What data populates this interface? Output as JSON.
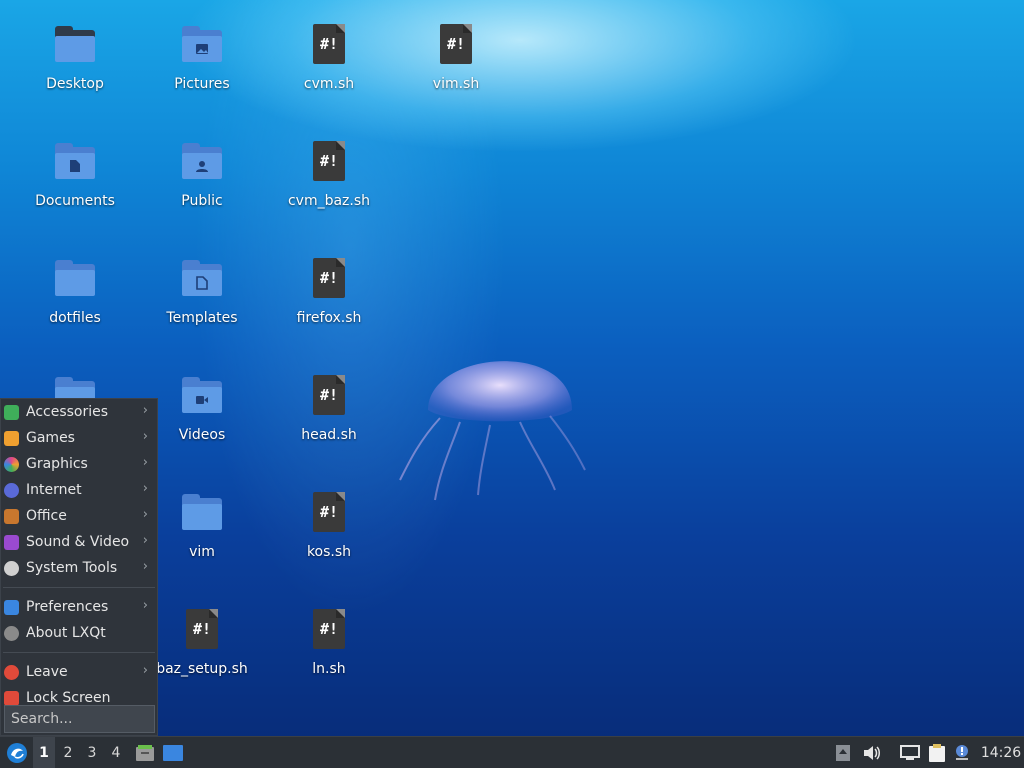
{
  "desktop": {
    "icons": [
      {
        "label": "Desktop",
        "kind": "folder-desktop"
      },
      {
        "label": "Pictures",
        "kind": "folder-pictures"
      },
      {
        "label": "cvm.sh",
        "kind": "script"
      },
      {
        "label": "vim.sh",
        "kind": "script"
      },
      {
        "label": "Documents",
        "kind": "folder-documents"
      },
      {
        "label": "Public",
        "kind": "folder-public"
      },
      {
        "label": "cvm_baz.sh",
        "kind": "script"
      },
      {
        "label": "dotfiles",
        "kind": "folder"
      },
      {
        "label": "Templates",
        "kind": "folder-templates"
      },
      {
        "label": "firefox.sh",
        "kind": "script"
      },
      {
        "label": "Videos",
        "kind": "folder-videos"
      },
      {
        "label": "head.sh",
        "kind": "script"
      },
      {
        "label": "vim",
        "kind": "folder"
      },
      {
        "label": "kos.sh",
        "kind": "script"
      },
      {
        "label": "baz_setup.sh",
        "kind": "script"
      },
      {
        "label": "ln.sh",
        "kind": "script"
      }
    ],
    "script_glyph": "#!"
  },
  "menu": {
    "categories": [
      {
        "label": "Accessories",
        "icon": "accessories-icon",
        "color": "#3fae5a"
      },
      {
        "label": "Games",
        "icon": "games-icon",
        "color": "#f0a030"
      },
      {
        "label": "Graphics",
        "icon": "graphics-icon",
        "color": "#e0458a"
      },
      {
        "label": "Internet",
        "icon": "internet-icon",
        "color": "#5a6ad8"
      },
      {
        "label": "Office",
        "icon": "office-icon",
        "color": "#c8772e"
      },
      {
        "label": "Sound & Video",
        "icon": "sound-video-icon",
        "color": "#9a4ad0"
      },
      {
        "label": "System Tools",
        "icon": "system-tools-icon",
        "color": "#d0d0d0"
      }
    ],
    "preferences": {
      "label": "Preferences",
      "icon": "preferences-icon",
      "color": "#3a86e0"
    },
    "about": {
      "label": "About LXQt",
      "icon": "info-icon",
      "color": "#8a8a8a"
    },
    "leave": {
      "label": "Leave",
      "icon": "power-icon",
      "color": "#e04a3a"
    },
    "lock": {
      "label": "Lock Screen",
      "icon": "lock-icon",
      "color": "#e04a3a"
    },
    "search_placeholder": "Search...",
    "submenu_arrow": "›"
  },
  "taskbar": {
    "workspaces": [
      "1",
      "2",
      "3",
      "4"
    ],
    "active_workspace": "1",
    "clock": "14:26"
  },
  "colors": {
    "accent": "#3a86e0",
    "panel": "#2b3036",
    "menu_bg": "#2f343b"
  }
}
